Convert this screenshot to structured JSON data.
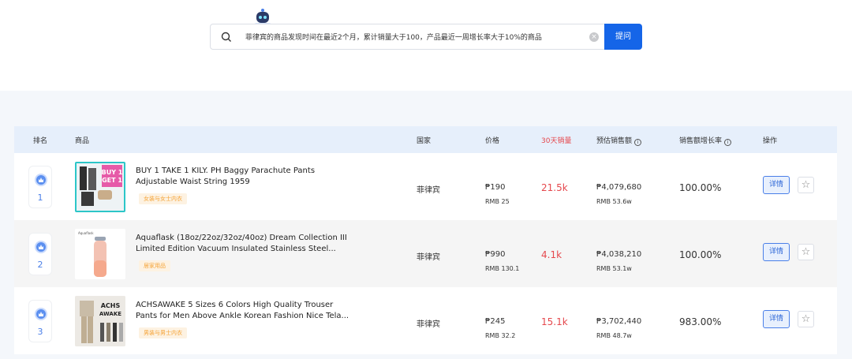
{
  "search": {
    "query": "菲律宾的商品发现时间在最近2个月，累计销量大于100，产品最近一周增长率大于10%的商品",
    "clear_icon": "clear-icon",
    "submit_label": "提问"
  },
  "table": {
    "headers": {
      "rank": "排名",
      "product": "商品",
      "country": "国家",
      "price": "价格",
      "sales30": "30天销量",
      "est_revenue": "预估销售额",
      "growth": "销售额增长率",
      "action": "操作"
    },
    "rows": [
      {
        "rank": "1",
        "name_line1": "BUY 1 TAKE 1 KILY. PH Baggy Parachute Pants",
        "name_line2": "Adjustable Waist String 1959",
        "tag": "女装与女士内衣",
        "thumb_text1": "BUY 1",
        "thumb_text2": "GET 1",
        "country": "菲律宾",
        "price": "₱190",
        "price_rmb": "RMB 25",
        "sales30": "21.5k",
        "revenue": "₱4,079,680",
        "revenue_rmb": "RMB 53.6w",
        "growth": "100.00%",
        "detail_label": "详情"
      },
      {
        "rank": "2",
        "name_line1": "Aquaflask (18oz/22oz/32oz/40oz) Dream Collection III",
        "name_line2": "Limited Edition Vacuum Insulated Stainless Steel...",
        "tag": "居家用品",
        "thumb_text1": "Aquaflask",
        "thumb_text2": "",
        "country": "菲律宾",
        "price": "₱990",
        "price_rmb": "RMB 130.1",
        "sales30": "4.1k",
        "revenue": "₱4,038,210",
        "revenue_rmb": "RMB 53.1w",
        "growth": "100.00%",
        "detail_label": "详情"
      },
      {
        "rank": "3",
        "name_line1": "ACHSAWAKE 5 Sizes 6 Colors High Quality Trouser",
        "name_line2": "Pants for Men Above Ankle Korean Fashion Nice Tela...",
        "tag": "男装与男士内衣",
        "thumb_text1": "ACHS",
        "thumb_text2": "AWAKE",
        "country": "菲律宾",
        "price": "₱245",
        "price_rmb": "RMB 32.2",
        "sales30": "15.1k",
        "revenue": "₱3,702,440",
        "revenue_rmb": "RMB 48.7w",
        "growth": "983.00%",
        "detail_label": "详情"
      }
    ]
  },
  "colors": {
    "accent": "#1565e8",
    "sales_red": "#e5484d",
    "tag_orange": "#f5a234",
    "header_bg": "#e6effb"
  }
}
